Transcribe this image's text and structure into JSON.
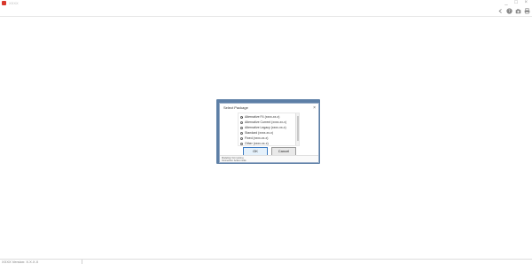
{
  "window": {
    "title": "XXXX",
    "controls": "_ □ ×"
  },
  "toolbar": {
    "buttons": [
      {
        "icon": "back-icon"
      },
      {
        "icon": "help-icon"
      },
      {
        "icon": "camera-icon"
      },
      {
        "icon": "print-icon"
      }
    ]
  },
  "dialog": {
    "title": "Select Package",
    "close_label": "×",
    "options": [
      {
        "label": "Alternative F4 (xxxx-xx-x)",
        "checked": true
      },
      {
        "label": "Alternative Current (xxxx-xx-x)",
        "checked": false
      },
      {
        "label": "Alternative Legacy (xxxx-xx-x)",
        "checked": false
      },
      {
        "label": "Standard (xxxx-xx-x)",
        "checked": false
      },
      {
        "label": "Fixed (xxxx-xx-x)",
        "checked": false
      },
      {
        "label": "Other (xxxx-xx-x)",
        "checked": false
      }
    ],
    "ok_label": "OK",
    "cancel_label": "Cancel",
    "status_line1": "Modeling: Not running",
    "status_line2": "Connection: Active mode"
  },
  "statusbar": {
    "text": "XXXX Version: X.X.X.X"
  },
  "colors": {
    "accent": "#3e7cc2",
    "dialog_frame": "#5d7fa6",
    "app_icon": "#d9372b"
  }
}
